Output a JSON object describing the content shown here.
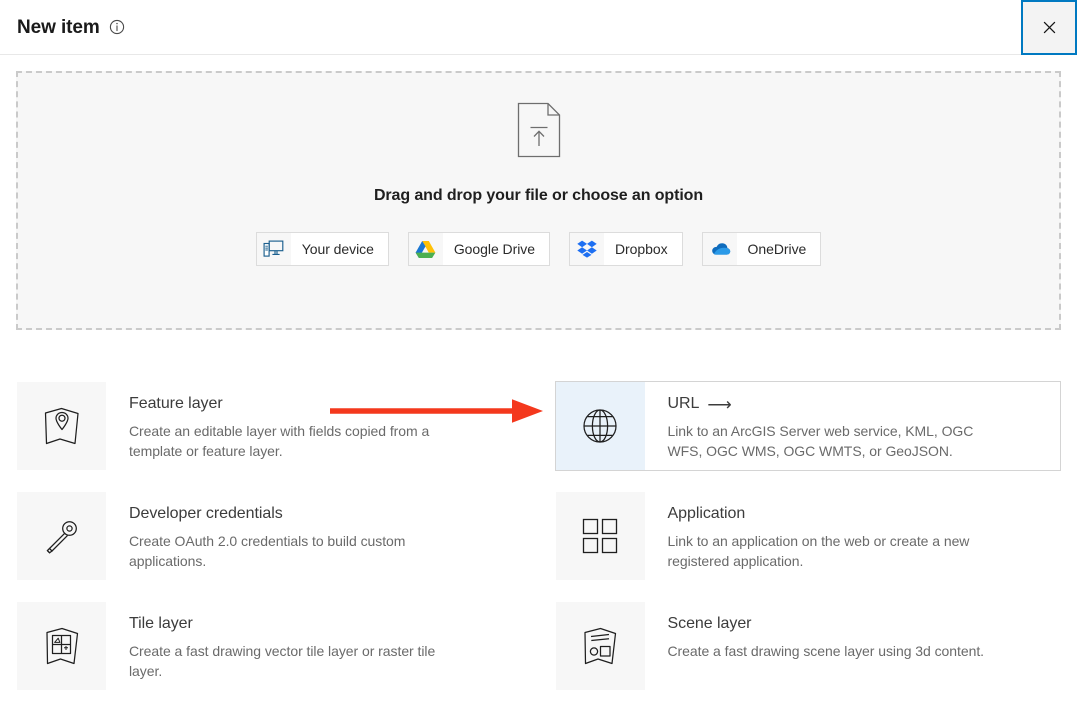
{
  "header": {
    "title": "New item",
    "info_icon": "info-circle-icon",
    "close_icon": "close-icon",
    "close_label": "Close"
  },
  "dropzone": {
    "upload_icon": "file-upload-icon",
    "prompt": "Drag and drop your file or choose an option",
    "sources": [
      {
        "label": "Your device",
        "icon": "desktop-computer-icon"
      },
      {
        "label": "Google Drive",
        "icon": "google-drive-icon"
      },
      {
        "label": "Dropbox",
        "icon": "dropbox-icon"
      },
      {
        "label": "OneDrive",
        "icon": "onedrive-icon"
      }
    ]
  },
  "item_types": [
    {
      "title": "Feature layer",
      "arrow": "",
      "description": "Create an editable layer with fields copied from a template or feature layer.",
      "icon": "map-pin-layer-icon",
      "active": false
    },
    {
      "title": "URL",
      "arrow": "⟶",
      "description": "Link to an ArcGIS Server web service, KML, OGC WFS, OGC WMS, OGC WMTS, or GeoJSON.",
      "icon": "globe-icon",
      "active": true
    },
    {
      "title": "Developer credentials",
      "arrow": "",
      "description": "Create OAuth 2.0 credentials to build custom applications.",
      "icon": "key-icon",
      "active": false
    },
    {
      "title": "Application",
      "arrow": "",
      "description": "Link to an application on the web or create a new registered application.",
      "icon": "grid-squares-icon",
      "active": false
    },
    {
      "title": "Tile layer",
      "arrow": "",
      "description": "Create a fast drawing vector tile layer or raster tile layer.",
      "icon": "tile-layer-icon",
      "active": false
    },
    {
      "title": "Scene layer",
      "arrow": "",
      "description": "Create a fast drawing scene layer using 3d content.",
      "icon": "scene-layer-icon",
      "active": false
    }
  ],
  "annotation": {
    "type": "arrow",
    "color": "#f4381d",
    "points_to": "URL"
  },
  "colors": {
    "accent_blue": "#0079c1",
    "highlight_blue": "#e9f2fa",
    "panel_gray": "#f7f7f7",
    "border_gray": "#d4d4d4",
    "annotation_red": "#f4381d"
  }
}
